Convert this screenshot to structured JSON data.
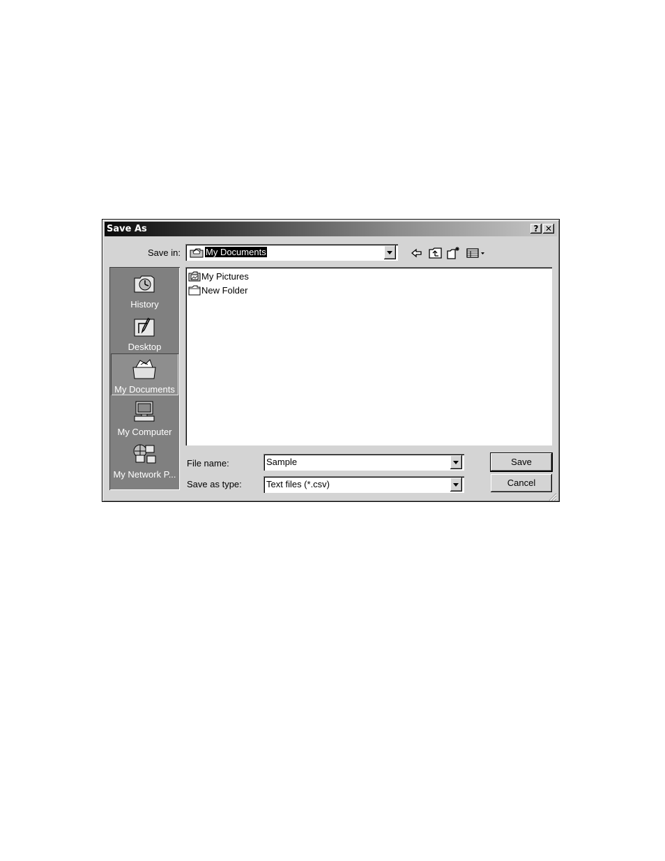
{
  "window": {
    "title": "Save As",
    "help_glyph": "?",
    "close_glyph": "✕"
  },
  "toolbar": {
    "save_in_label": "Save in:",
    "save_in_value": "My Documents",
    "icons": [
      "back-icon",
      "up-folder-icon",
      "new-folder-icon",
      "views-menu-icon"
    ]
  },
  "places": [
    {
      "label": "History",
      "icon": "history-icon",
      "selected": false
    },
    {
      "label": "Desktop",
      "icon": "desktop-icon",
      "selected": false
    },
    {
      "label": "My Documents",
      "icon": "my-documents-icon",
      "selected": true
    },
    {
      "label": "My Computer",
      "icon": "my-computer-icon",
      "selected": false
    },
    {
      "label": "My Network P...",
      "icon": "my-network-places-icon",
      "selected": false
    }
  ],
  "files": [
    {
      "name": "My Pictures",
      "icon": "pictures-folder-icon"
    },
    {
      "name": "New Folder",
      "icon": "folder-icon"
    }
  ],
  "fields": {
    "file_name_label": "File name:",
    "file_name_value": "Sample",
    "save_as_type_label": "Save as type:",
    "save_as_type_value": "Text files (*.csv)"
  },
  "buttons": {
    "save": "Save",
    "cancel": "Cancel"
  }
}
